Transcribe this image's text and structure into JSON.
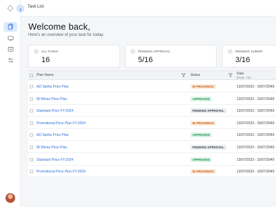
{
  "header": {
    "breadcrumb": "Task List"
  },
  "main": {
    "title": "Welcome back,",
    "subtitle": "Here's an overview of your task for today."
  },
  "cards": [
    {
      "label": "ALL TASKS",
      "value": "16"
    },
    {
      "label": "PENDING APPROVAL",
      "value": "5/16"
    },
    {
      "label": "PENDING SUBMIT",
      "value": "3/16"
    }
  ],
  "table": {
    "headers": {
      "plan_name": "Plan Name",
      "status": "Status",
      "date": "Date",
      "date_sub": "(From - To)"
    },
    "rows": [
      {
        "name": "AD Spirits Price Plan",
        "status": "IN PROGRESS",
        "date": "13/07/2023 - 15/07/2049"
      },
      {
        "name": "IB Wines Price Plan",
        "status": "APPROVED",
        "date": "13/07/2023 - 15/07/2049"
      },
      {
        "name": "Standard Price FY-2024",
        "status": "PENDING APPROVAL",
        "date": "13/07/2023 - 15/07/2049"
      },
      {
        "name": "Promotional Price Plan FY-2024",
        "status": "IN PROGRESS",
        "date": "13/07/2023 - 15/07/2049"
      },
      {
        "name": "AD Spirits Price Plan",
        "status": "APPROVED",
        "date": "13/07/2023 - 15/07/2049"
      },
      {
        "name": "IB Wines Price Plan",
        "status": "PENDING APPROVAL",
        "date": "13/07/2023 - 15/07/2049"
      },
      {
        "name": "Standard Price FY-2024",
        "status": "APPROVED",
        "date": "13/07/2023 - 15/07/2049"
      },
      {
        "name": "Promotional Price Plan FY-2024",
        "status": "IN PROGRESS",
        "date": "13/07/2023 - 15/07/2049"
      }
    ]
  },
  "status_colors": {
    "IN PROGRESS": {
      "bg": "#fdebd9",
      "fg": "#c2571a"
    },
    "APPROVED": {
      "bg": "#d9f5e6",
      "fg": "#1f8a4c"
    },
    "PENDING APPROVAL": {
      "bg": "#e9ebee",
      "fg": "#3d434a"
    }
  },
  "icons": {
    "logo": "logo-icon",
    "back": "chevron-left-icon",
    "nav": [
      "documents-icon",
      "monitor-icon",
      "inbox-icon",
      "settings-sliders-icon"
    ],
    "filter": "filter-icon"
  },
  "colors": {
    "accent": "#2e6fd8",
    "active_nav_bg": "#dbeafe"
  }
}
